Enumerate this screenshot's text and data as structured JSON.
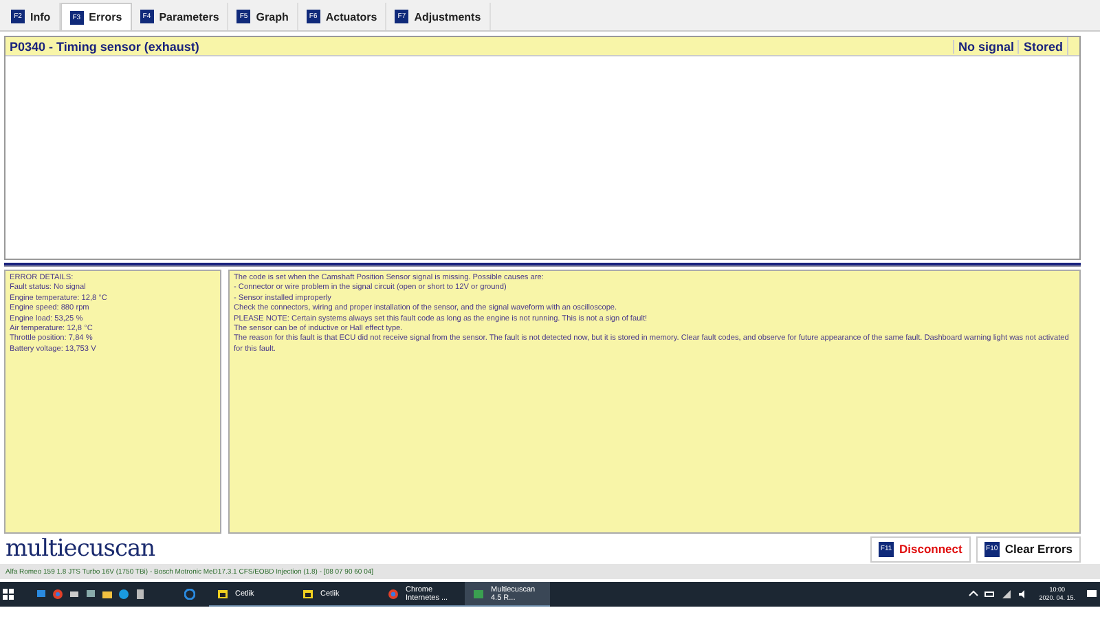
{
  "tabs": [
    {
      "key": "F2",
      "label": "Info",
      "selected": false
    },
    {
      "key": "F3",
      "label": "Errors",
      "selected": true
    },
    {
      "key": "F4",
      "label": "Parameters",
      "selected": false
    },
    {
      "key": "F5",
      "label": "Graph",
      "selected": false
    },
    {
      "key": "F6",
      "label": "Actuators",
      "selected": false
    },
    {
      "key": "F7",
      "label": "Adjustments",
      "selected": false
    }
  ],
  "errors": {
    "rows": [
      {
        "description": "P0340 - Timing sensor (exhaust)",
        "status": "No signal",
        "type": "Stored"
      }
    ]
  },
  "details": {
    "lines": [
      "ERROR DETAILS:",
      "Fault status: No signal",
      "Engine temperature: 12,8 °C",
      "Engine speed: 880 rpm",
      "Engine load: 53,25 %",
      "Air temperature: 12,8 °C",
      "Throttle position: 7,84 %",
      "Battery voltage: 13,753 V"
    ]
  },
  "description": {
    "lines": [
      "The code is set when the Camshaft Position Sensor signal is missing. Possible causes are:",
      "- Connector or wire problem in the signal circuit (open or short to 12V or ground)",
      "- Sensor installed improperly",
      "Check the connectors, wiring and proper installation of the sensor, and the signal waveform with an oscilloscope.",
      "PLEASE NOTE: Certain systems always set this fault code as long as the engine is not running. This is not a sign of fault!",
      "The sensor can be of inductive or Hall effect type.",
      "The reason for this fault is that ECU did not receive signal from the sensor. The fault is not detected now, but it is stored in memory. Clear fault codes, and observe for future appearance of the same fault. Dashboard warning light was not activated for this fault."
    ]
  },
  "logo": "multiecuscan",
  "buttons": [
    {
      "key": "F11",
      "label": "Disconnect",
      "kind": "danger"
    },
    {
      "key": "F10",
      "label": "Clear Errors",
      "kind": "normal"
    }
  ],
  "status_bar": "Alfa Romeo 159 1.8 JTS Turbo 16V (1750 TBi) - Bosch Motronic MeD17.3.1 CFS/EOBD Injection (1.8) - [08 07 90 60 04]",
  "taskbar": {
    "windows": [
      {
        "label": "Cetlik",
        "kind": "folder",
        "selected": false
      },
      {
        "label": "Cetlik",
        "kind": "folder",
        "selected": false
      },
      {
        "label": "Chrome Internetes ...",
        "kind": "browser",
        "selected": false
      },
      {
        "label": "Multiecuscan 4.5 R...",
        "kind": "app",
        "selected": true
      }
    ],
    "time": "10:00",
    "date": "2020. 04. 15."
  }
}
